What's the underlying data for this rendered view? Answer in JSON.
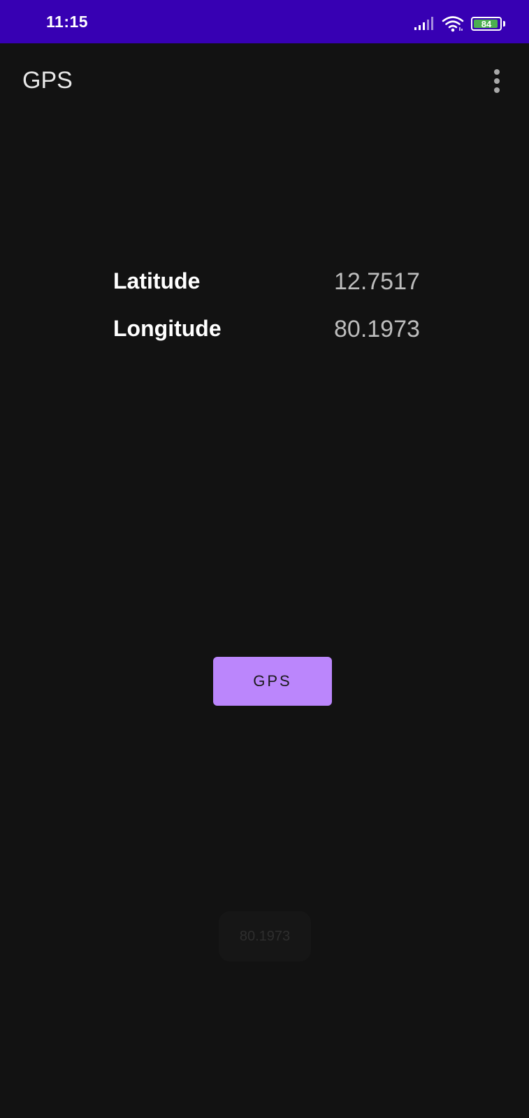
{
  "status_bar": {
    "time": "11:15",
    "battery_level": "84",
    "icons": [
      "signal-icon",
      "wifi-icon",
      "battery-icon"
    ],
    "background_color": "#3700b3"
  },
  "app_bar": {
    "title": "GPS",
    "overflow_icon": "more-vert-icon"
  },
  "location": {
    "latitude_label": "Latitude",
    "latitude_value": "12.7517",
    "longitude_label": "Longitude",
    "longitude_value": "80.1973"
  },
  "actions": {
    "gps_button_label": "GPS",
    "accent_color": "#bb86fc"
  },
  "toast": {
    "text": "80.1973"
  }
}
